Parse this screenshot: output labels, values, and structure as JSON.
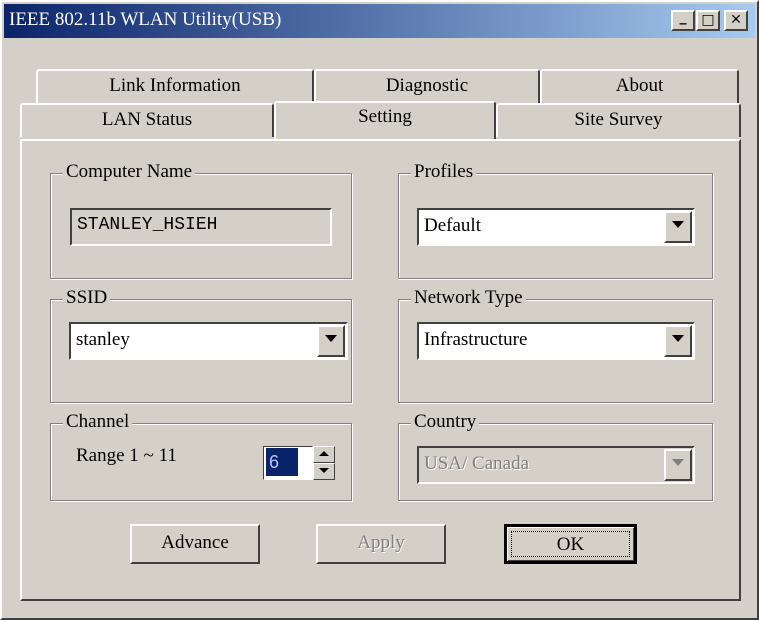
{
  "window": {
    "title": "IEEE 802.11b WLAN Utility(USB)"
  },
  "titlebar_buttons": {
    "minimize": "_",
    "maximize": "□",
    "close": "✕"
  },
  "tabs_row1": [
    {
      "label": "Link Information"
    },
    {
      "label": "Diagnostic"
    },
    {
      "label": "About"
    }
  ],
  "tabs_row2": [
    {
      "label": "LAN Status"
    },
    {
      "label": "Setting",
      "active": true
    },
    {
      "label": "Site Survey"
    }
  ],
  "computer_name": {
    "legend": "Computer Name",
    "value": "STANLEY_HSIEH"
  },
  "profiles": {
    "legend": "Profiles",
    "value": "Default"
  },
  "ssid": {
    "legend": "SSID",
    "value": "stanley"
  },
  "network_type": {
    "legend": "Network Type",
    "value": "Infrastructure"
  },
  "channel": {
    "legend": "Channel",
    "range_label": "Range 1 ~ 11",
    "value": "6"
  },
  "country": {
    "legend": "Country",
    "value": "USA/ Canada",
    "disabled": true
  },
  "buttons": {
    "advance": "Advance",
    "apply": "Apply",
    "ok": "OK"
  },
  "colors": {
    "face": "#d4d0c8",
    "title_start": "#0a246a",
    "title_end": "#a6caf0",
    "selection": "#0a246a"
  }
}
